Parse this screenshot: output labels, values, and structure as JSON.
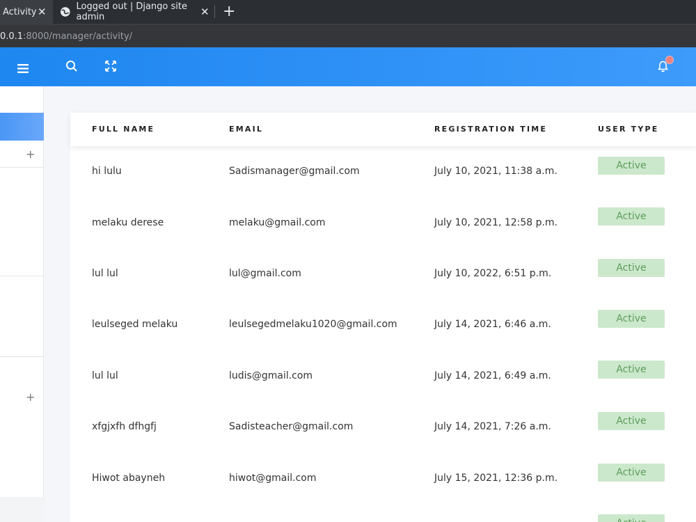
{
  "browser": {
    "tabs": [
      {
        "label": "Activity",
        "active": true
      },
      {
        "label": "Logged out | Django site admin",
        "active": false
      }
    ],
    "url_host": "0.0.1",
    "url_rest": ":8000/manager/activity/"
  },
  "colors": {
    "header_gradient_start": "#1e87f0",
    "header_gradient_end": "#3d9bfb",
    "badge_bg": "#cce8cc",
    "badge_text": "#5c9c5c"
  },
  "header": {
    "icons": [
      "menu-icon",
      "search-icon",
      "fullscreen-icon",
      "bell-icon"
    ]
  },
  "table": {
    "columns": [
      "FULL NAME",
      "EMAIL",
      "REGISTRATION TIME",
      "USER TYPE"
    ],
    "rows": [
      {
        "name": "hi lulu",
        "email": "Sadismanager@gmail.com",
        "time": "July 10, 2021, 11:38 a.m.",
        "status": "Active"
      },
      {
        "name": "melaku derese",
        "email": "melaku@gmail.com",
        "time": "July 10, 2021, 12:58 p.m.",
        "status": "Active"
      },
      {
        "name": "lul lul",
        "email": "lul@gmail.com",
        "time": "July 10, 2022, 6:51 p.m.",
        "status": "Active"
      },
      {
        "name": "leulseged melaku",
        "email": "leulsegedmelaku1020@gmail.com",
        "time": "July 14, 2021, 6:46 a.m.",
        "status": "Active"
      },
      {
        "name": "lul lul",
        "email": "ludis@gmail.com",
        "time": "July 14, 2021, 6:49 a.m.",
        "status": "Active"
      },
      {
        "name": "xfgjxfh dfhgfj",
        "email": "Sadisteacher@gmail.com",
        "time": "July 14, 2021, 7:26 a.m.",
        "status": "Active"
      },
      {
        "name": "Hiwot abayneh",
        "email": "hiwot@gmail.com",
        "time": "July 15, 2021, 12:36 p.m.",
        "status": "Active"
      }
    ],
    "partial_row_status": "Active"
  }
}
